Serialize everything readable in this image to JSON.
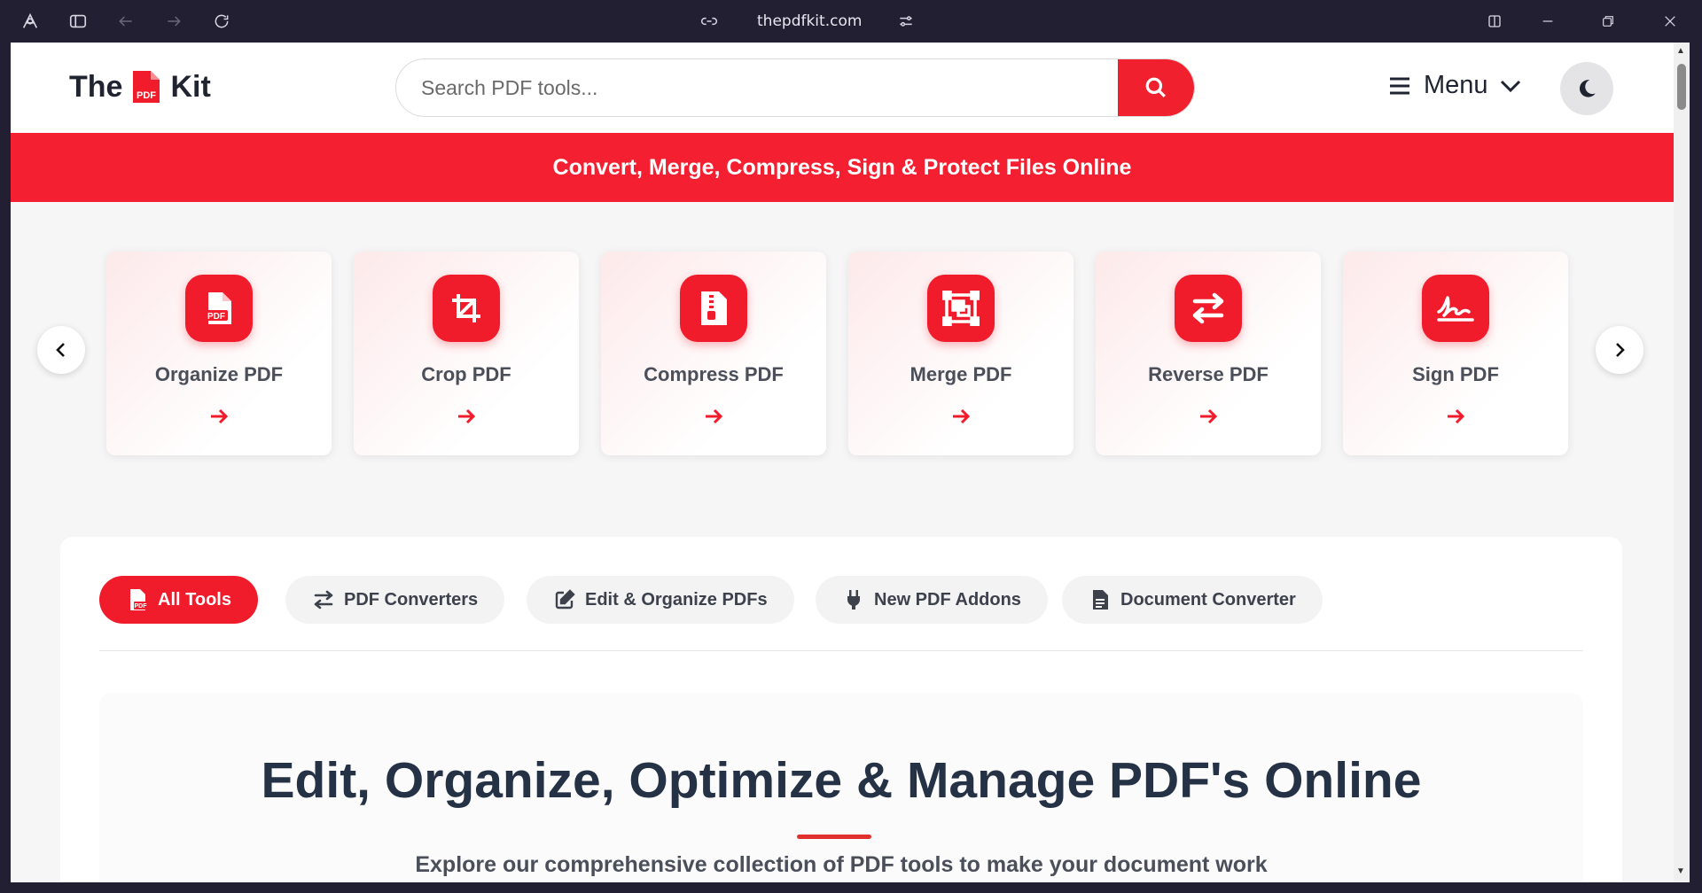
{
  "browser": {
    "url": "thepdfkit.com"
  },
  "header": {
    "logo_left": "The",
    "logo_mark": "PDF",
    "logo_right": "Kit",
    "search_placeholder": "Search PDF tools...",
    "menu_label": "Menu"
  },
  "banner": {
    "text": "Convert, Merge, Compress, Sign & Protect Files Online"
  },
  "carousel": {
    "cards": [
      {
        "title": "Organize PDF",
        "icon": "file-pdf-icon"
      },
      {
        "title": "Crop PDF",
        "icon": "crop-icon"
      },
      {
        "title": "Compress PDF",
        "icon": "file-zipper-icon"
      },
      {
        "title": "Merge PDF",
        "icon": "object-group-icon"
      },
      {
        "title": "Reverse PDF",
        "icon": "right-left-icon"
      },
      {
        "title": "Sign PDF",
        "icon": "signature-icon"
      }
    ]
  },
  "tabs": [
    {
      "label": "All Tools",
      "icon": "file-pdf-icon",
      "active": true
    },
    {
      "label": "PDF Converters",
      "icon": "right-left-icon",
      "active": false
    },
    {
      "label": "Edit & Organize PDFs",
      "icon": "pen-to-square-icon",
      "active": false
    },
    {
      "label": "New PDF Addons",
      "icon": "plug-icon",
      "active": false
    },
    {
      "label": "Document Converter",
      "icon": "file-lines-icon",
      "active": false
    }
  ],
  "intro": {
    "heading": "Edit, Organize, Optimize & Manage PDF's Online",
    "subtitle": "Explore our comprehensive collection of PDF tools to make your document work"
  },
  "colors": {
    "brand_red": "#f01c2c",
    "heading": "#253246",
    "chrome_bg": "#231f33"
  }
}
